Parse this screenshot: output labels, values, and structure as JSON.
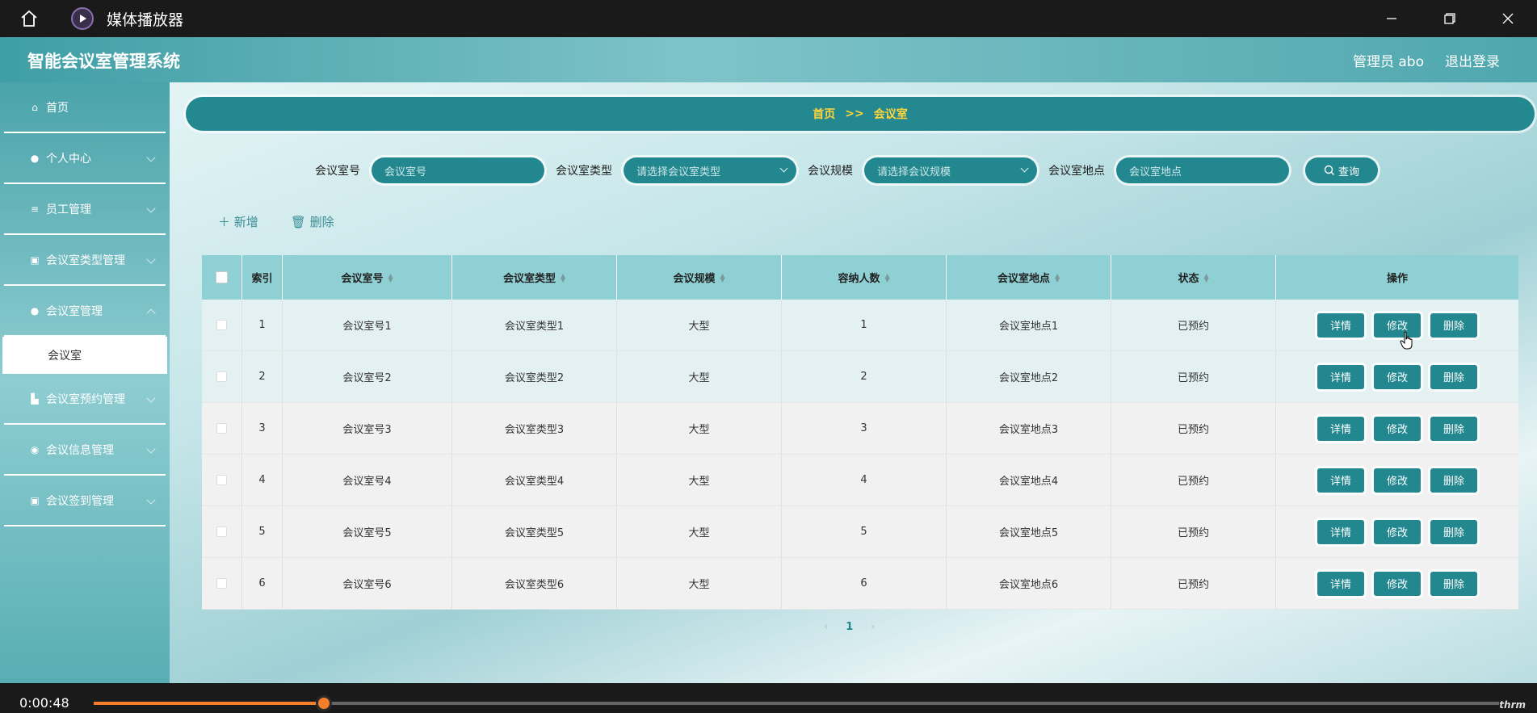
{
  "window": {
    "title": "媒体播放器"
  },
  "header": {
    "brand": "智能会议室管理系统",
    "admin": "管理员 abo",
    "logout": "退出登录"
  },
  "sidebar": {
    "items": [
      {
        "label": "首页",
        "icon": "home-icon",
        "expandable": false
      },
      {
        "label": "个人中心",
        "icon": "user-icon",
        "expandable": true
      },
      {
        "label": "员工管理",
        "icon": "list-icon",
        "expandable": true
      },
      {
        "label": "会议室类型管理",
        "icon": "clipboard-icon",
        "expandable": true
      },
      {
        "label": "会议室管理",
        "icon": "person-icon",
        "expandable": true
      },
      {
        "label": "会议室预约管理",
        "icon": "building-icon",
        "expandable": true
      },
      {
        "label": "会议信息管理",
        "icon": "pin-icon",
        "expandable": true
      },
      {
        "label": "会议签到管理",
        "icon": "clipboard-icon",
        "expandable": true
      }
    ],
    "submenu_label": "会议室"
  },
  "breadcrumb": {
    "home": "首页",
    "sep": ">>",
    "current": "会议室"
  },
  "filters": {
    "room_no_label": "会议室号",
    "room_no_placeholder": "会议室号",
    "type_label": "会议室类型",
    "type_placeholder": "请选择会议室类型",
    "scale_label": "会议规模",
    "scale_placeholder": "请选择会议规模",
    "location_label": "会议室地点",
    "location_placeholder": "会议室地点",
    "query": "查询"
  },
  "actions": {
    "add": "新增",
    "delete": "删除"
  },
  "table": {
    "headers": [
      "索引",
      "会议室号",
      "会议室类型",
      "会议规模",
      "容纳人数",
      "会议室地点",
      "状态",
      "操作"
    ],
    "rows": [
      {
        "idx": "1",
        "room": "会议室号1",
        "type": "会议室类型1",
        "scale": "大型",
        "capacity": "1",
        "location": "会议室地点1",
        "status": "已预约"
      },
      {
        "idx": "2",
        "room": "会议室号2",
        "type": "会议室类型2",
        "scale": "大型",
        "capacity": "2",
        "location": "会议室地点2",
        "status": "已预约"
      },
      {
        "idx": "3",
        "room": "会议室号3",
        "type": "会议室类型3",
        "scale": "大型",
        "capacity": "3",
        "location": "会议室地点3",
        "status": "已预约"
      },
      {
        "idx": "4",
        "room": "会议室号4",
        "type": "会议室类型4",
        "scale": "大型",
        "capacity": "4",
        "location": "会议室地点4",
        "status": "已预约"
      },
      {
        "idx": "5",
        "room": "会议室号5",
        "type": "会议室类型5",
        "scale": "大型",
        "capacity": "5",
        "location": "会议室地点5",
        "status": "已预约"
      },
      {
        "idx": "6",
        "room": "会议室号6",
        "type": "会议室类型6",
        "scale": "大型",
        "capacity": "6",
        "location": "会议室地点6",
        "status": "已预约"
      }
    ],
    "btn_detail": "详情",
    "btn_edit": "修改",
    "btn_delete": "删除"
  },
  "pagination": {
    "prev": "‹",
    "current": "1",
    "next": "›"
  },
  "player": {
    "time": "0:00:48",
    "progress": 0.164,
    "watermark": "thrm"
  },
  "colors": {
    "accent": "#22878e",
    "crumb_text": "#ffd43b",
    "progress": "#f47e2a"
  }
}
